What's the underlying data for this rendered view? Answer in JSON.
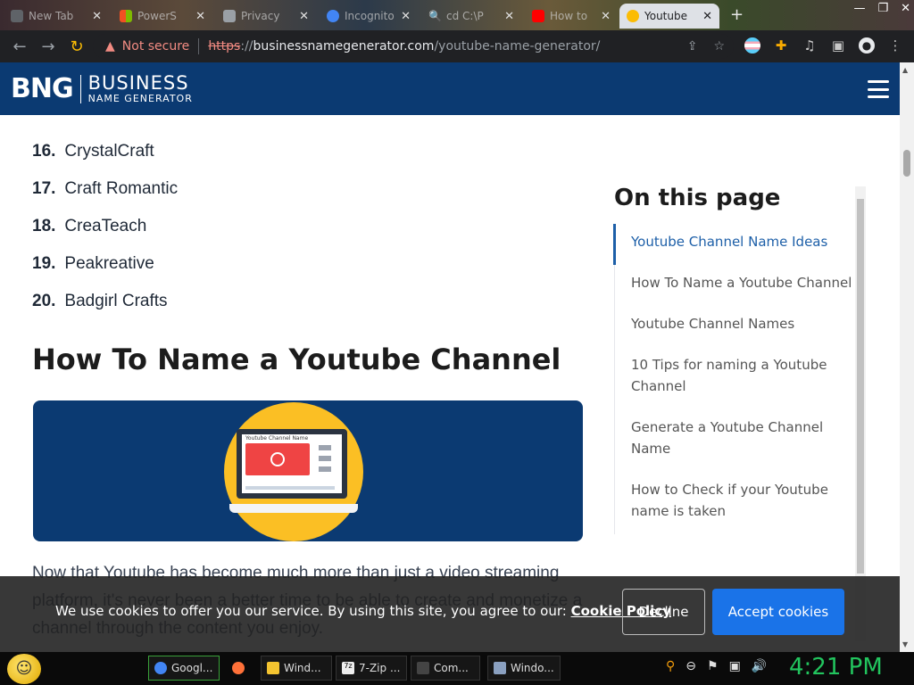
{
  "browser": {
    "tabs": [
      {
        "label": "New Tab",
        "color": "#5f6368"
      },
      {
        "label": "PowerS",
        "color": "#e94235"
      },
      {
        "label": "Privacy",
        "color": "#9aa0a6"
      },
      {
        "label": "Incognito",
        "color": "#4285f4"
      },
      {
        "label": "cd C:\\P",
        "color": "#4285f4"
      },
      {
        "label": "How to",
        "color": "#ff0000"
      },
      {
        "label": "Youtube",
        "color": "#fbbc04"
      }
    ],
    "new_tab_label": "+",
    "not_secure_label": "Not secure",
    "url_scheme": "https",
    "url_sep": "://",
    "url_host": "businessnamegenerator.com",
    "url_path": "/youtube-name-generator/"
  },
  "site": {
    "logo_mark": "BNG",
    "logo_top": "BUSINESS",
    "logo_bottom": "NAME GENERATOR"
  },
  "list": [
    {
      "num": "16.",
      "name": "CrystalCraft"
    },
    {
      "num": "17.",
      "name": "Craft Romantic"
    },
    {
      "num": "18.",
      "name": "CreaTeach"
    },
    {
      "num": "19.",
      "name": "Peakreative"
    },
    {
      "num": "20.",
      "name": "Badgirl Crafts"
    }
  ],
  "section_heading": "How To Name a Youtube Channel",
  "banner": {
    "screen_title": "Youtube Channel Name"
  },
  "paragraph": "Now that Youtube has become much more than just a video streaming platform, it's never been a better time to be able to create and monetize a channel through the content you enjoy.",
  "toc": {
    "title": "On this page",
    "items": [
      "Youtube Channel Name Ideas",
      "How To Name a Youtube Channel",
      "Youtube Channel Names",
      "10 Tips for naming a Youtube Channel",
      "Generate a Youtube Channel Name",
      "How to Check if your Youtube name is taken"
    ]
  },
  "cookie": {
    "text": "We use cookies to offer you our service. By using this site, you agree to our: ",
    "link": "Cookie Policy",
    "decline": "Decline",
    "accept": "Accept cookies"
  },
  "taskbar": {
    "items": [
      {
        "label": "Googl...",
        "color": "#4285f4"
      },
      {
        "label": "",
        "color": "#ff7139"
      },
      {
        "label": "Wind...",
        "color": "#f4c430"
      },
      {
        "label": "7-Zip ...",
        "color": "#222222"
      },
      {
        "label": "Com...",
        "color": "#444444"
      },
      {
        "label": "Windo...",
        "color": "#8aa0c0"
      }
    ],
    "clock": "4:21 PM"
  }
}
